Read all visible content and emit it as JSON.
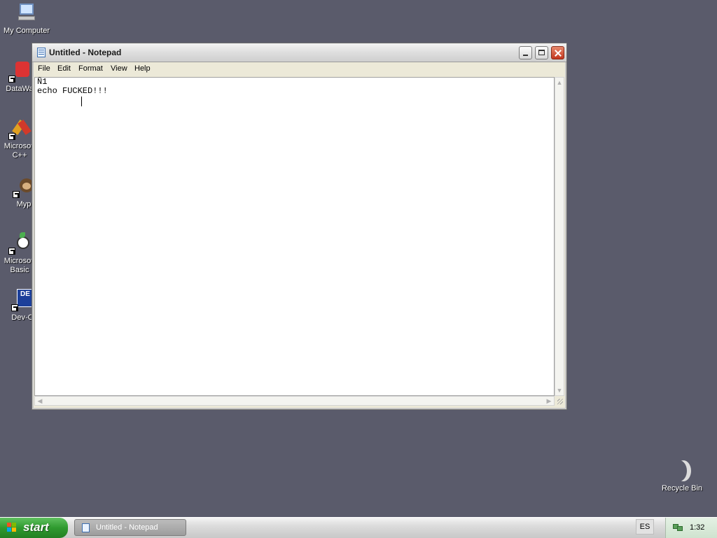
{
  "desktop": {
    "icons": [
      {
        "label": "My Computer"
      },
      {
        "label": "DataWa"
      },
      {
        "label": "Microsoft\nC++"
      },
      {
        "label": "Myp"
      },
      {
        "label": "Microsoft\nBasic"
      },
      {
        "label": "Dev-C"
      }
    ],
    "recycle_bin": "Recycle Bin"
  },
  "window": {
    "title": "Untitled - Notepad",
    "menu": [
      "File",
      "Edit",
      "Format",
      "View",
      "Help"
    ],
    "content": "Ñ1\necho FUCKED!!!"
  },
  "taskbar": {
    "start_label": "start",
    "task_button": "Untitled - Notepad",
    "language": "ES",
    "clock": "1:32"
  }
}
